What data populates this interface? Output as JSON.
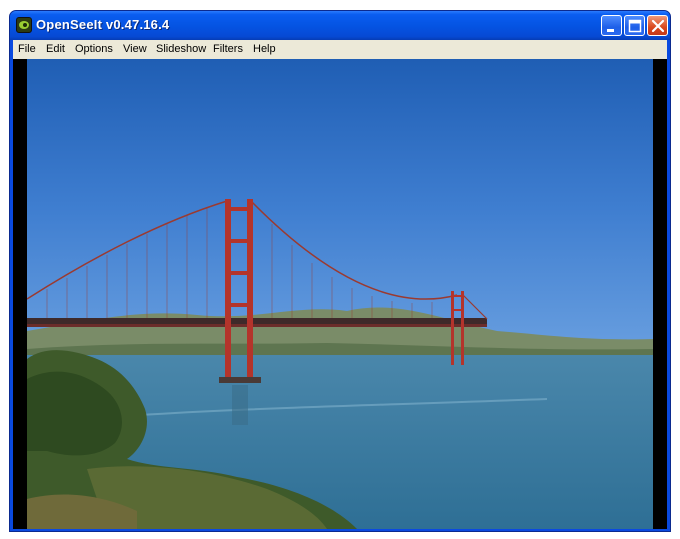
{
  "window": {
    "title": "OpenSeeIt v0.47.16.4",
    "app_icon": "openseeit-eye-icon",
    "controls": {
      "minimize_icon": "minimize-icon",
      "maximize_icon": "maximize-icon",
      "close_icon": "close-icon"
    }
  },
  "menu": {
    "file": "File",
    "edit": "Edit",
    "options": "Options",
    "view": "View",
    "slideshow": "Slideshow",
    "filters": "Filters",
    "help": "Help"
  },
  "viewer": {
    "image_subject": "golden-gate-bridge-photo"
  },
  "colors": {
    "titlebar": "#0554e3",
    "menubar": "#ece9d8",
    "canvas_background": "#000000",
    "close_button": "#d9471c"
  }
}
